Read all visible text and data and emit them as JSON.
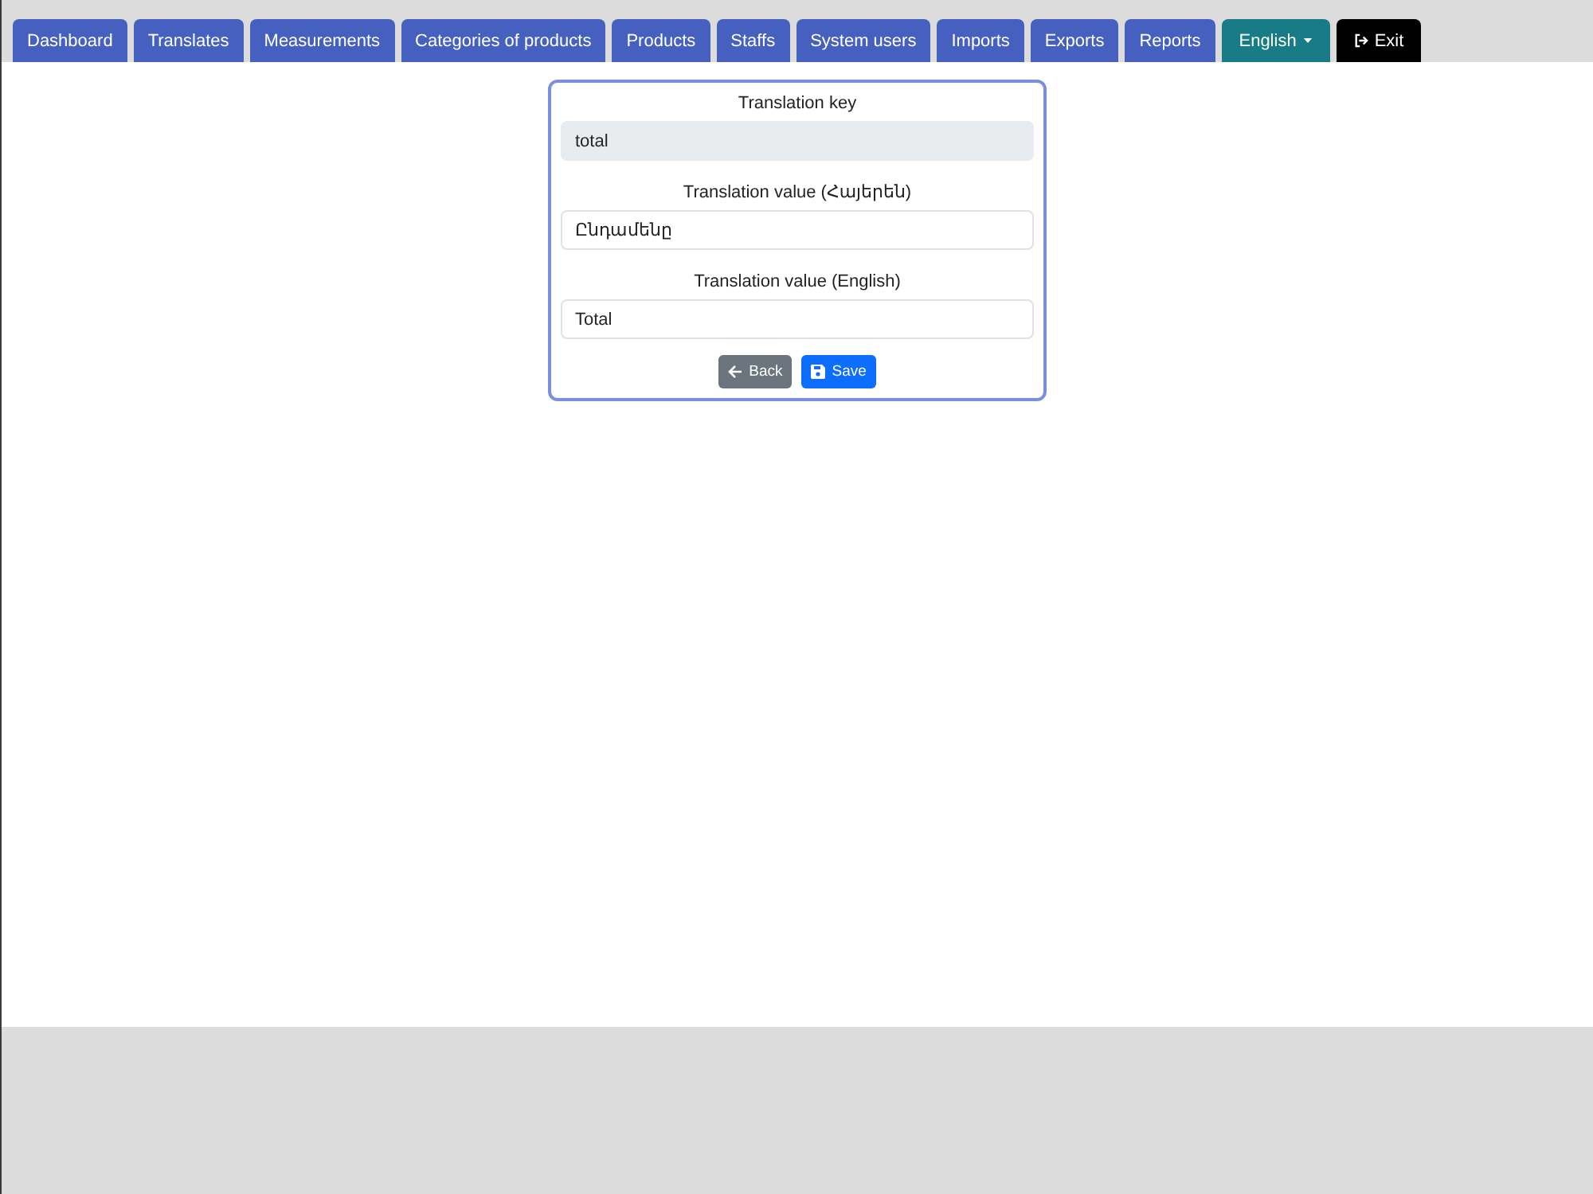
{
  "nav": {
    "tabs": [
      {
        "label": "Dashboard",
        "kind": "link"
      },
      {
        "label": "Translates",
        "kind": "link"
      },
      {
        "label": "Measurements",
        "kind": "link"
      },
      {
        "label": "Categories of products",
        "kind": "link"
      },
      {
        "label": "Products",
        "kind": "link"
      },
      {
        "label": "Staffs",
        "kind": "link"
      },
      {
        "label": "System users",
        "kind": "link"
      },
      {
        "label": "Imports",
        "kind": "link"
      },
      {
        "label": "Exports",
        "kind": "link"
      },
      {
        "label": "Reports",
        "kind": "link"
      },
      {
        "label": "English",
        "kind": "language"
      },
      {
        "label": "Exit",
        "kind": "exit"
      }
    ]
  },
  "form": {
    "fields": [
      {
        "label": "Translation key",
        "value": "total",
        "readonly": true
      },
      {
        "label": "Translation value (Հայերեն)",
        "value": "Ընդամենը",
        "readonly": false
      },
      {
        "label": "Translation value (English)",
        "value": "Total",
        "readonly": false
      }
    ],
    "buttons": [
      {
        "label": "Back",
        "kind": "back"
      },
      {
        "label": "Save",
        "kind": "save"
      }
    ]
  }
}
